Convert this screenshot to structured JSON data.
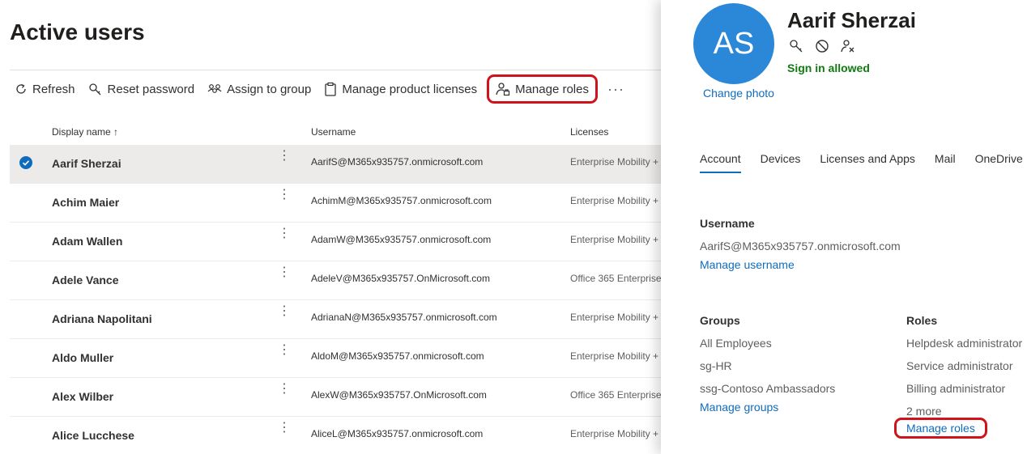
{
  "page": {
    "title": "Active users"
  },
  "toolbar": {
    "refresh": "Refresh",
    "reset_password": "Reset password",
    "assign_to_group": "Assign to group",
    "manage_product_licenses": "Manage product licenses",
    "manage_roles": "Manage roles",
    "more": "···"
  },
  "grid": {
    "columns": {
      "display_name": "Display name",
      "sort_indicator": "↑",
      "username": "Username",
      "licenses": "Licenses"
    },
    "rows": [
      {
        "name": "Aarif Sherzai",
        "username": "AarifS@M365x935757.onmicrosoft.com",
        "licenses": "Enterprise Mobility +",
        "selected": true
      },
      {
        "name": "Achim Maier",
        "username": "AchimM@M365x935757.onmicrosoft.com",
        "licenses": "Enterprise Mobility +"
      },
      {
        "name": "Adam Wallen",
        "username": "AdamW@M365x935757.onmicrosoft.com",
        "licenses": "Enterprise Mobility +"
      },
      {
        "name": "Adele Vance",
        "username": "AdeleV@M365x935757.OnMicrosoft.com",
        "licenses": "Office 365 Enterprise"
      },
      {
        "name": "Adriana Napolitani",
        "username": "AdrianaN@M365x935757.onmicrosoft.com",
        "licenses": "Enterprise Mobility +"
      },
      {
        "name": "Aldo Muller",
        "username": "AldoM@M365x935757.onmicrosoft.com",
        "licenses": "Enterprise Mobility +"
      },
      {
        "name": "Alex Wilber",
        "username": "AlexW@M365x935757.OnMicrosoft.com",
        "licenses": "Office 365 Enterprise"
      },
      {
        "name": "Alice Lucchese",
        "username": "AliceL@M365x935757.onmicrosoft.com",
        "licenses": "Enterprise Mobility +"
      }
    ],
    "row_menu": "⋮"
  },
  "panel": {
    "initials": "AS",
    "change_photo": "Change photo",
    "name": "Aarif Sherzai",
    "status": "Sign in allowed",
    "icons": [
      "key-icon",
      "block-icon",
      "remove-user-icon"
    ],
    "tabs": [
      "Account",
      "Devices",
      "Licenses and Apps",
      "Mail",
      "OneDrive"
    ],
    "active_tab": "Account",
    "username_heading": "Username",
    "username_value": "AarifS@M365x935757.onmicrosoft.com",
    "manage_username": "Manage username",
    "groups_heading": "Groups",
    "groups": [
      "All Employees",
      "sg-HR",
      "ssg-Contoso Ambassadors"
    ],
    "manage_groups": "Manage groups",
    "roles_heading": "Roles",
    "roles": [
      "Helpdesk administrator",
      "Service administrator",
      "Billing administrator"
    ],
    "roles_more": "2 more",
    "manage_roles": "Manage roles"
  },
  "colors": {
    "accent": "#0f6cbd",
    "avatar": "#2b88d8",
    "success": "#107c10",
    "highlight": "#d0121b"
  }
}
